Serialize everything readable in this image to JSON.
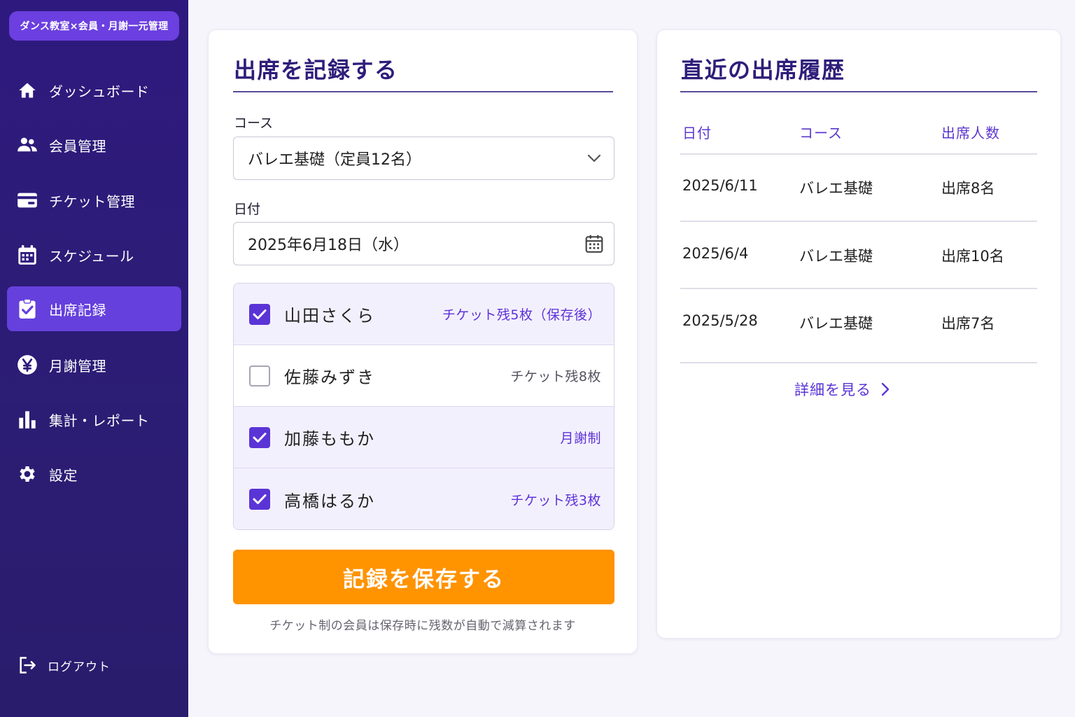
{
  "app": {
    "brand": "ダンス教室×会員・月謝一元管理",
    "accent_color": "#6540dd",
    "sidebar_color": "#2e1a7e",
    "save_color": "#ff9300"
  },
  "sidebar": {
    "items": [
      {
        "label": "ダッシュボード",
        "icon": "home-icon"
      },
      {
        "label": "会員管理",
        "icon": "users-icon"
      },
      {
        "label": "チケット管理",
        "icon": "ticket-card-icon"
      },
      {
        "label": "スケジュール",
        "icon": "calendar-icon"
      },
      {
        "label": "出席記録",
        "icon": "clipboard-check-icon",
        "active": true
      },
      {
        "label": "月謝管理",
        "icon": "yen-icon"
      },
      {
        "label": "集計・レポート",
        "icon": "bar-chart-icon"
      },
      {
        "label": "設定",
        "icon": "gear-icon"
      }
    ],
    "logout": "ログアウト"
  },
  "record": {
    "title": "出席を記録する",
    "course_label": "コース",
    "course_value": "バレエ基礎（定員12名）",
    "date_label": "日付",
    "date_value": "2025年6月18日（水）",
    "members": [
      {
        "name": "山田さくら",
        "note": "チケット残5枚（保存後）",
        "checked": true
      },
      {
        "name": "佐藤みずき",
        "note": "チケット残8枚",
        "checked": false
      },
      {
        "name": "加藤ももか",
        "note": "月謝制",
        "checked": true
      },
      {
        "name": "高橋はるか",
        "note": "チケット残3枚",
        "checked": true
      }
    ],
    "save_label": "記録を保存する",
    "save_note": "チケット制の会員は保存時に残数が自動で減算されます"
  },
  "history": {
    "title": "直近の出席履歴",
    "columns": [
      "日付",
      "コース",
      "出席人数"
    ],
    "rows": [
      [
        "2025/6/11",
        "バレエ基礎",
        "出席8名"
      ],
      [
        "2025/6/4",
        "バレエ基礎",
        "出席10名"
      ],
      [
        "2025/5/28",
        "バレエ基礎",
        "出席7名"
      ]
    ],
    "detail_link": "詳細を見る"
  }
}
